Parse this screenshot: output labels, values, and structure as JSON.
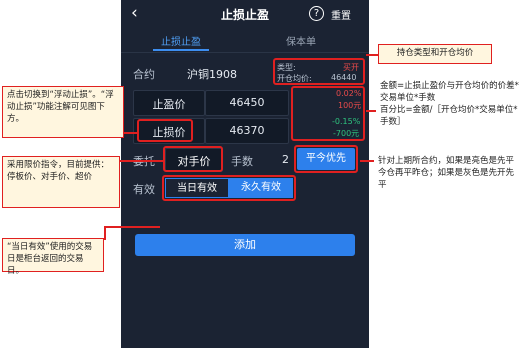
{
  "nav": {
    "back_icon": "chevron-left-icon",
    "title": "止损止盈",
    "help_icon": "question-circle-icon",
    "reset_label": "重置"
  },
  "tabs": [
    {
      "label": "止损止盈",
      "active": true
    },
    {
      "label": "保本单",
      "active": false
    }
  ],
  "contract": {
    "label": "合约",
    "name": "沪铜1908"
  },
  "position": {
    "type_label": "类型:",
    "type_value": "买开",
    "price_label": "开仓均价:",
    "price_value": "46440"
  },
  "take_profit": {
    "label": "止盈价",
    "value": "46450",
    "pct": "0.02%",
    "amount": "100元"
  },
  "stop_loss": {
    "label": "止损价",
    "value": "46370",
    "pct": "-0.15%",
    "amount": "-700元"
  },
  "order": {
    "label": "委托",
    "price_type": "对手价",
    "qty_label": "手数",
    "qty_value": "2",
    "close_mode": "平今优先"
  },
  "validity": {
    "label": "有效",
    "options": [
      "当日有效",
      "永久有效"
    ],
    "selected": "永久有效"
  },
  "add_button": "添加",
  "colors": {
    "accent": "#2d80ec",
    "profit": "#e84a4a",
    "loss": "#2ec27e",
    "annotation": "#e02020"
  },
  "annotations": {
    "position_note": "持仓类型和开仓均价",
    "amount_note": "金额=止损止盈价与开仓均价的价差*交易单位*手数\n百分比=金额/［开仓均价*交易单位*手数］",
    "floating_note": "点击切换到“浮动止损”。“浮动止损”功能注解可见图下方。",
    "price_type_note": "采用限价指令，目前提供：停板价、对手价、超价",
    "close_mode_note": "针对上期所合约，如果是亮色是先平今仓再平昨仓；如果是灰色是先开先平",
    "validity_note": "“当日有效”使用的交易日是柜台返回的交易日。"
  }
}
